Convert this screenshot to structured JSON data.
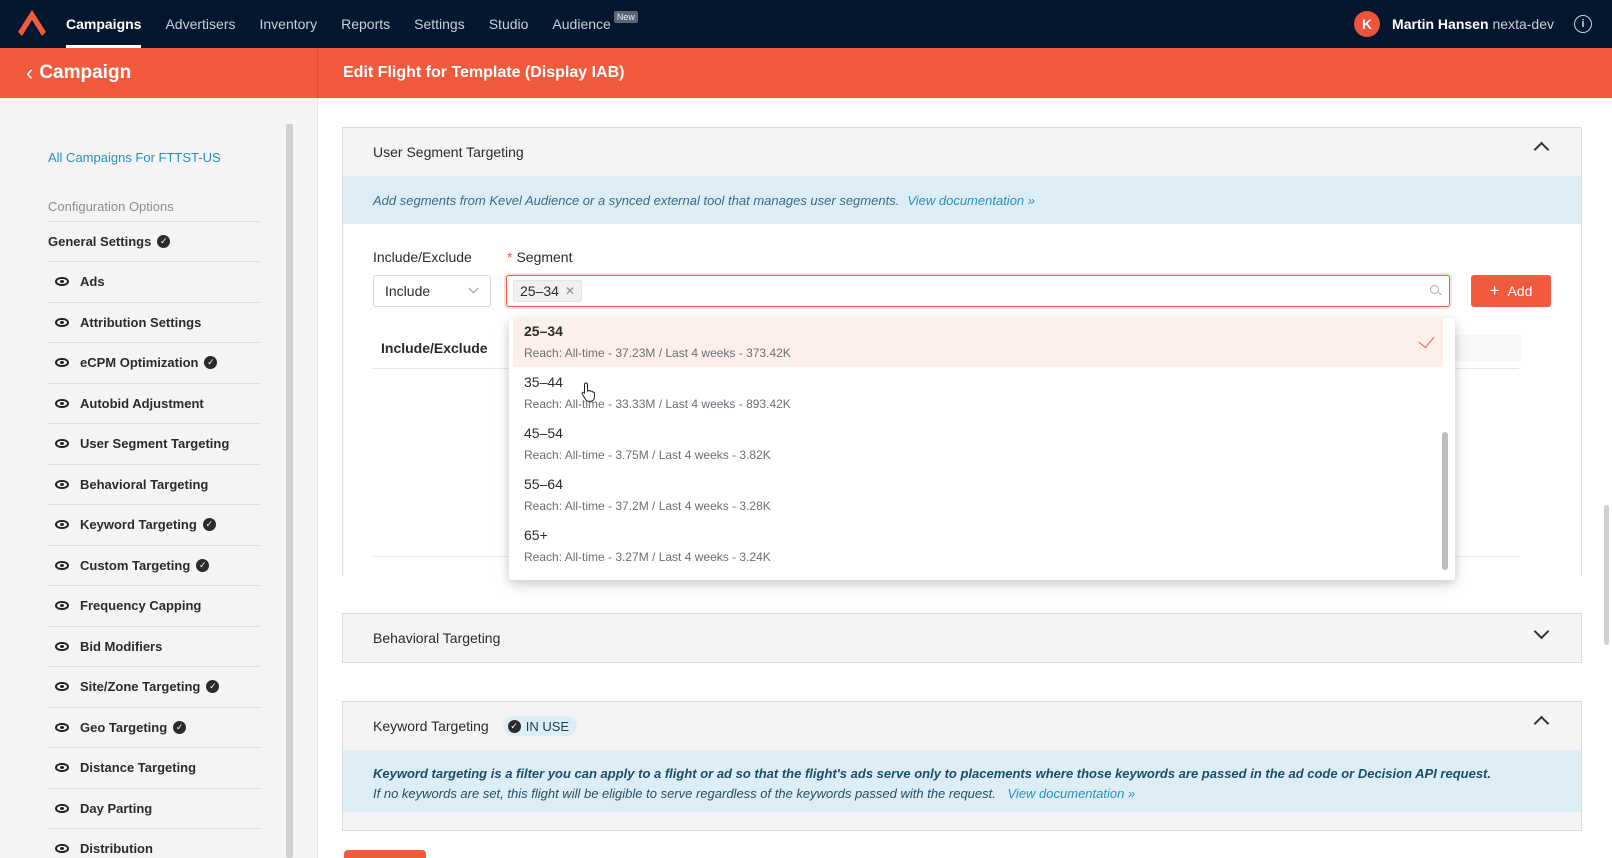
{
  "topnav": {
    "items": [
      {
        "label": "Campaigns",
        "active": true
      },
      {
        "label": "Advertisers"
      },
      {
        "label": "Inventory"
      },
      {
        "label": "Reports"
      },
      {
        "label": "Settings"
      },
      {
        "label": "Studio"
      },
      {
        "label": "Audience",
        "badge": "New"
      }
    ],
    "user_initial": "K",
    "user_name": "Martin Hansen",
    "user_org": "nexta-dev",
    "info_symbol": "i"
  },
  "subheader": {
    "back_label": "Campaign",
    "title": "Edit Flight for Template (Display IAB)"
  },
  "sidebar": {
    "all_campaigns": "All Campaigns For FTTST-US",
    "config_label": "Configuration Options",
    "general": {
      "label": "General Settings",
      "checked": true
    },
    "items": [
      {
        "label": "Ads",
        "checked": false
      },
      {
        "label": "Attribution Settings",
        "checked": false
      },
      {
        "label": "eCPM Optimization",
        "checked": true
      },
      {
        "label": "Autobid Adjustment",
        "checked": false
      },
      {
        "label": "User Segment Targeting",
        "checked": false
      },
      {
        "label": "Behavioral Targeting",
        "checked": false
      },
      {
        "label": "Keyword Targeting",
        "checked": true
      },
      {
        "label": "Custom Targeting",
        "checked": true
      },
      {
        "label": "Frequency Capping",
        "checked": false
      },
      {
        "label": "Bid Modifiers",
        "checked": false
      },
      {
        "label": "Site/Zone Targeting",
        "checked": true
      },
      {
        "label": "Geo Targeting",
        "checked": true
      },
      {
        "label": "Distance Targeting",
        "checked": false
      },
      {
        "label": "Day Parting",
        "checked": false
      },
      {
        "label": "Distribution",
        "checked": false
      }
    ]
  },
  "user_segment": {
    "title": "User Segment Targeting",
    "info_text": "Add segments from Kevel Audience or a synced external tool that manages user segments.",
    "info_link": "View documentation »",
    "include_label": "Include/Exclude",
    "segment_label": "Segment",
    "required_mark": "*",
    "include_value": "Include",
    "selected_tag": "25–34",
    "add_label": "Add",
    "table_header": "Include/Exclude",
    "options": [
      {
        "title": "25–34",
        "reach": "Reach: All-time - 37.23M / Last 4 weeks - 373.42K",
        "selected": true
      },
      {
        "title": "35–44",
        "reach": "Reach: All-time - 33.33M / Last 4 weeks - 893.42K"
      },
      {
        "title": "45–54",
        "reach": "Reach: All-time - 3.75M / Last 4 weeks - 3.82K"
      },
      {
        "title": "55–64",
        "reach": "Reach: All-time - 37.2M / Last 4 weeks - 3.28K"
      },
      {
        "title": "65+",
        "reach": "Reach: All-time - 3.27M / Last 4 weeks - 3.24K"
      }
    ]
  },
  "behavioral": {
    "title": "Behavioral Targeting"
  },
  "keyword": {
    "title": "Keyword Targeting",
    "badge": "IN USE",
    "info_bold": "Keyword targeting is a filter you can apply to a flight or ad so that the flight's ads serve only to placements where those keywords are passed in the ad code or Decision API request.",
    "info_text": "If no keywords are set, this flight will be eligible to serve regardless of the keywords passed with the request.",
    "info_link": "View documentation »"
  },
  "colors": {
    "accent": "#f25a3e",
    "nav_bg": "#04172f",
    "link": "#2a8fb8",
    "info_bg": "#dcedf5"
  }
}
